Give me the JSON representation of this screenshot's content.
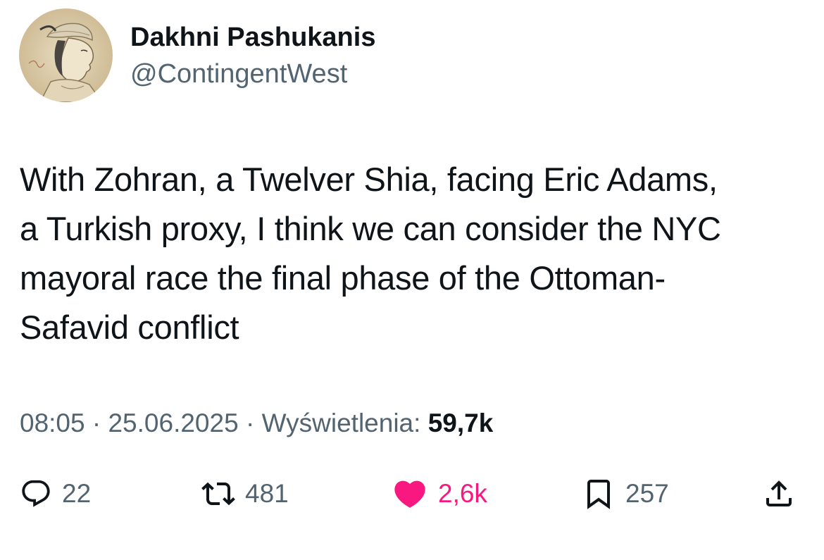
{
  "author": {
    "display_name": "Dakhni Pashukanis",
    "handle": "@ContingentWest",
    "avatar_icon": "portrait-avatar"
  },
  "tweet": {
    "text": "With Zohran, a Twelver Shia, facing Eric Adams,\na Turkish proxy, I think we can consider the NYC\nmayoral race the final phase of the Ottoman-\nSafavid conflict"
  },
  "meta": {
    "time": "08:05",
    "separator": " · ",
    "date": "25.06.2025",
    "views_label": "Wyświetlenia:",
    "views_count": "59,7k"
  },
  "actions": {
    "reply": {
      "icon": "reply-icon",
      "count": "22"
    },
    "retweet": {
      "icon": "retweet-icon",
      "count": "481"
    },
    "like": {
      "icon": "heart-icon",
      "count": "2,6k",
      "active": true
    },
    "bookmark": {
      "icon": "bookmark-icon",
      "count": "257"
    },
    "share": {
      "icon": "share-icon"
    }
  },
  "colors": {
    "text_primary": "#0f1419",
    "text_secondary": "#536471",
    "like_active": "#f91880"
  }
}
